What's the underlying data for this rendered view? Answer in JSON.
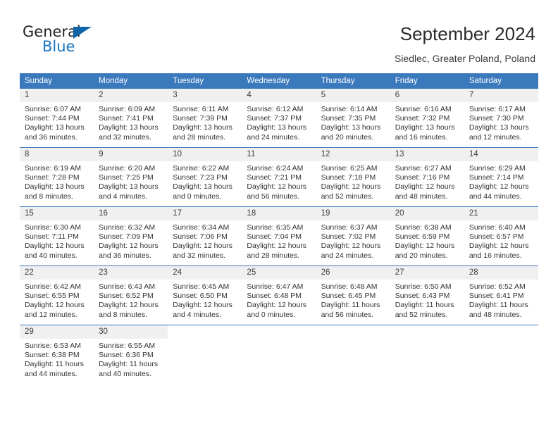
{
  "brand": {
    "name_top": "General",
    "name_bottom": "Blue",
    "triangle_color": "#1065a8",
    "text_color_top": "#231f20",
    "text_color_bottom": "#1874c0"
  },
  "header": {
    "title": "September 2024",
    "subtitle": "Siedlec, Greater Poland, Poland"
  },
  "theme": {
    "header_blue": "#3b79bd",
    "daynum_bg": "#f0f0f0",
    "text": "#333333",
    "page_bg": "#ffffff"
  },
  "weekdays": [
    "Sunday",
    "Monday",
    "Tuesday",
    "Wednesday",
    "Thursday",
    "Friday",
    "Saturday"
  ],
  "weeks": [
    [
      {
        "day": "1",
        "sunrise": "Sunrise: 6:07 AM",
        "sunset": "Sunset: 7:44 PM",
        "daylight1": "Daylight: 13 hours",
        "daylight2": "and 36 minutes."
      },
      {
        "day": "2",
        "sunrise": "Sunrise: 6:09 AM",
        "sunset": "Sunset: 7:41 PM",
        "daylight1": "Daylight: 13 hours",
        "daylight2": "and 32 minutes."
      },
      {
        "day": "3",
        "sunrise": "Sunrise: 6:11 AM",
        "sunset": "Sunset: 7:39 PM",
        "daylight1": "Daylight: 13 hours",
        "daylight2": "and 28 minutes."
      },
      {
        "day": "4",
        "sunrise": "Sunrise: 6:12 AM",
        "sunset": "Sunset: 7:37 PM",
        "daylight1": "Daylight: 13 hours",
        "daylight2": "and 24 minutes."
      },
      {
        "day": "5",
        "sunrise": "Sunrise: 6:14 AM",
        "sunset": "Sunset: 7:35 PM",
        "daylight1": "Daylight: 13 hours",
        "daylight2": "and 20 minutes."
      },
      {
        "day": "6",
        "sunrise": "Sunrise: 6:16 AM",
        "sunset": "Sunset: 7:32 PM",
        "daylight1": "Daylight: 13 hours",
        "daylight2": "and 16 minutes."
      },
      {
        "day": "7",
        "sunrise": "Sunrise: 6:17 AM",
        "sunset": "Sunset: 7:30 PM",
        "daylight1": "Daylight: 13 hours",
        "daylight2": "and 12 minutes."
      }
    ],
    [
      {
        "day": "8",
        "sunrise": "Sunrise: 6:19 AM",
        "sunset": "Sunset: 7:28 PM",
        "daylight1": "Daylight: 13 hours",
        "daylight2": "and 8 minutes."
      },
      {
        "day": "9",
        "sunrise": "Sunrise: 6:20 AM",
        "sunset": "Sunset: 7:25 PM",
        "daylight1": "Daylight: 13 hours",
        "daylight2": "and 4 minutes."
      },
      {
        "day": "10",
        "sunrise": "Sunrise: 6:22 AM",
        "sunset": "Sunset: 7:23 PM",
        "daylight1": "Daylight: 13 hours",
        "daylight2": "and 0 minutes."
      },
      {
        "day": "11",
        "sunrise": "Sunrise: 6:24 AM",
        "sunset": "Sunset: 7:21 PM",
        "daylight1": "Daylight: 12 hours",
        "daylight2": "and 56 minutes."
      },
      {
        "day": "12",
        "sunrise": "Sunrise: 6:25 AM",
        "sunset": "Sunset: 7:18 PM",
        "daylight1": "Daylight: 12 hours",
        "daylight2": "and 52 minutes."
      },
      {
        "day": "13",
        "sunrise": "Sunrise: 6:27 AM",
        "sunset": "Sunset: 7:16 PM",
        "daylight1": "Daylight: 12 hours",
        "daylight2": "and 48 minutes."
      },
      {
        "day": "14",
        "sunrise": "Sunrise: 6:29 AM",
        "sunset": "Sunset: 7:14 PM",
        "daylight1": "Daylight: 12 hours",
        "daylight2": "and 44 minutes."
      }
    ],
    [
      {
        "day": "15",
        "sunrise": "Sunrise: 6:30 AM",
        "sunset": "Sunset: 7:11 PM",
        "daylight1": "Daylight: 12 hours",
        "daylight2": "and 40 minutes."
      },
      {
        "day": "16",
        "sunrise": "Sunrise: 6:32 AM",
        "sunset": "Sunset: 7:09 PM",
        "daylight1": "Daylight: 12 hours",
        "daylight2": "and 36 minutes."
      },
      {
        "day": "17",
        "sunrise": "Sunrise: 6:34 AM",
        "sunset": "Sunset: 7:06 PM",
        "daylight1": "Daylight: 12 hours",
        "daylight2": "and 32 minutes."
      },
      {
        "day": "18",
        "sunrise": "Sunrise: 6:35 AM",
        "sunset": "Sunset: 7:04 PM",
        "daylight1": "Daylight: 12 hours",
        "daylight2": "and 28 minutes."
      },
      {
        "day": "19",
        "sunrise": "Sunrise: 6:37 AM",
        "sunset": "Sunset: 7:02 PM",
        "daylight1": "Daylight: 12 hours",
        "daylight2": "and 24 minutes."
      },
      {
        "day": "20",
        "sunrise": "Sunrise: 6:38 AM",
        "sunset": "Sunset: 6:59 PM",
        "daylight1": "Daylight: 12 hours",
        "daylight2": "and 20 minutes."
      },
      {
        "day": "21",
        "sunrise": "Sunrise: 6:40 AM",
        "sunset": "Sunset: 6:57 PM",
        "daylight1": "Daylight: 12 hours",
        "daylight2": "and 16 minutes."
      }
    ],
    [
      {
        "day": "22",
        "sunrise": "Sunrise: 6:42 AM",
        "sunset": "Sunset: 6:55 PM",
        "daylight1": "Daylight: 12 hours",
        "daylight2": "and 12 minutes."
      },
      {
        "day": "23",
        "sunrise": "Sunrise: 6:43 AM",
        "sunset": "Sunset: 6:52 PM",
        "daylight1": "Daylight: 12 hours",
        "daylight2": "and 8 minutes."
      },
      {
        "day": "24",
        "sunrise": "Sunrise: 6:45 AM",
        "sunset": "Sunset: 6:50 PM",
        "daylight1": "Daylight: 12 hours",
        "daylight2": "and 4 minutes."
      },
      {
        "day": "25",
        "sunrise": "Sunrise: 6:47 AM",
        "sunset": "Sunset: 6:48 PM",
        "daylight1": "Daylight: 12 hours",
        "daylight2": "and 0 minutes."
      },
      {
        "day": "26",
        "sunrise": "Sunrise: 6:48 AM",
        "sunset": "Sunset: 6:45 PM",
        "daylight1": "Daylight: 11 hours",
        "daylight2": "and 56 minutes."
      },
      {
        "day": "27",
        "sunrise": "Sunrise: 6:50 AM",
        "sunset": "Sunset: 6:43 PM",
        "daylight1": "Daylight: 11 hours",
        "daylight2": "and 52 minutes."
      },
      {
        "day": "28",
        "sunrise": "Sunrise: 6:52 AM",
        "sunset": "Sunset: 6:41 PM",
        "daylight1": "Daylight: 11 hours",
        "daylight2": "and 48 minutes."
      }
    ],
    [
      {
        "day": "29",
        "sunrise": "Sunrise: 6:53 AM",
        "sunset": "Sunset: 6:38 PM",
        "daylight1": "Daylight: 11 hours",
        "daylight2": "and 44 minutes."
      },
      {
        "day": "30",
        "sunrise": "Sunrise: 6:55 AM",
        "sunset": "Sunset: 6:36 PM",
        "daylight1": "Daylight: 11 hours",
        "daylight2": "and 40 minutes."
      },
      {
        "day": "",
        "sunrise": "",
        "sunset": "",
        "daylight1": "",
        "daylight2": ""
      },
      {
        "day": "",
        "sunrise": "",
        "sunset": "",
        "daylight1": "",
        "daylight2": ""
      },
      {
        "day": "",
        "sunrise": "",
        "sunset": "",
        "daylight1": "",
        "daylight2": ""
      },
      {
        "day": "",
        "sunrise": "",
        "sunset": "",
        "daylight1": "",
        "daylight2": ""
      },
      {
        "day": "",
        "sunrise": "",
        "sunset": "",
        "daylight1": "",
        "daylight2": ""
      }
    ]
  ]
}
